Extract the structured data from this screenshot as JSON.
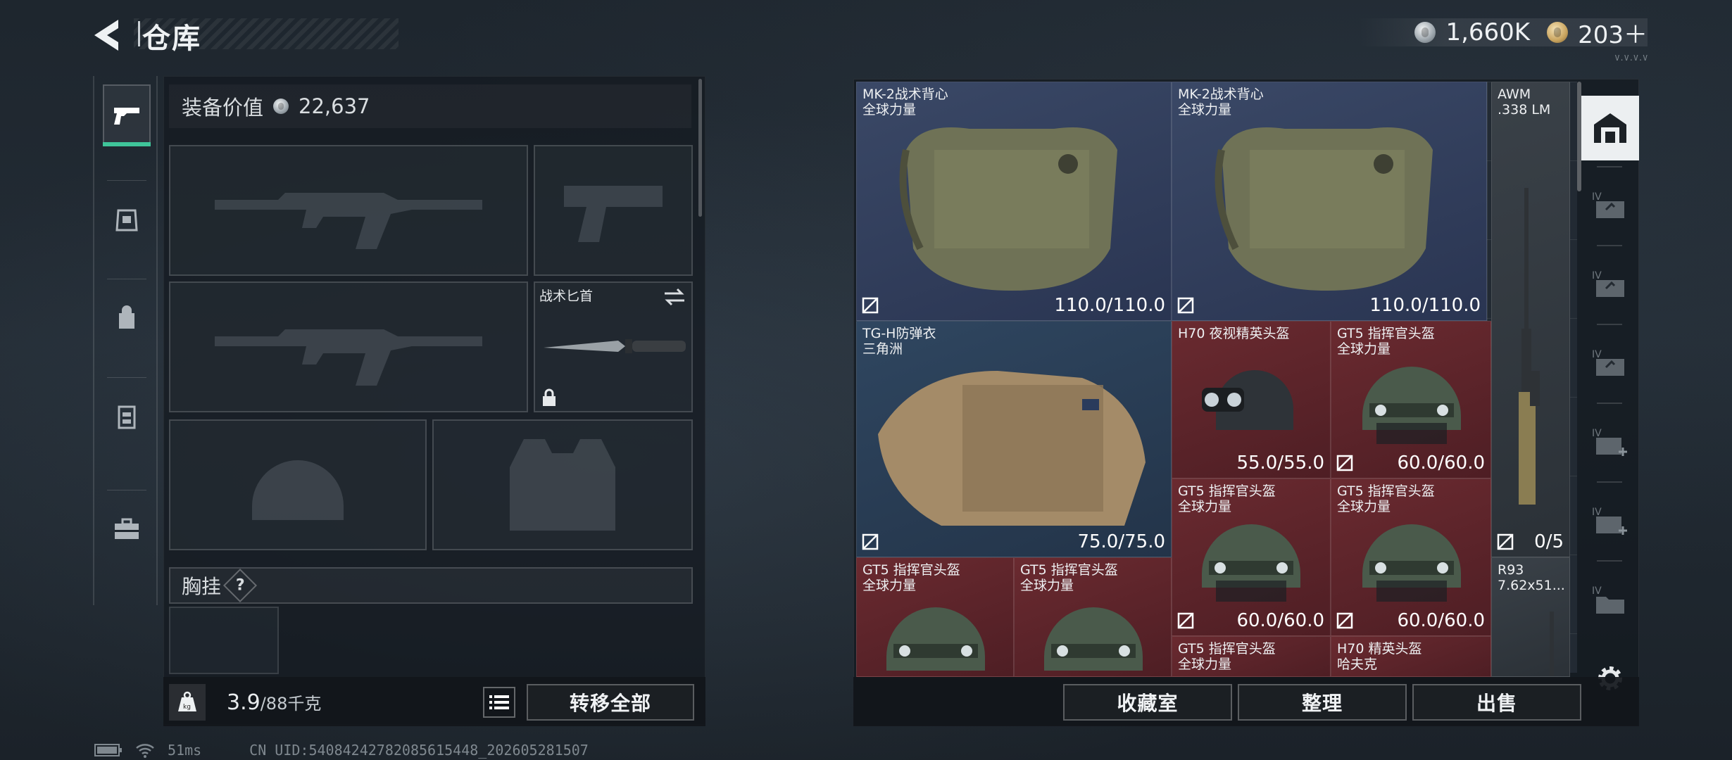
{
  "header": {
    "title": "仓库"
  },
  "currency": {
    "silver": "1,660K",
    "gold": "203＋"
  },
  "version_text": "V.V.V.V",
  "equipment": {
    "value_label": "装备价值",
    "value": "22,637",
    "knife_label": "战术匕首",
    "chest_label": "胸挂",
    "chest_help": "?",
    "weight_value": "3.9",
    "weight_limit": "/88千克",
    "weight_icon_text": "kg",
    "transfer_all": "转移全部"
  },
  "storage": {
    "items": [
      {
        "name": "MK-2战术背心\n全球力量",
        "durability": "110.0/110.0",
        "rarity": "blue"
      },
      {
        "name": "MK-2战术背心\n全球力量",
        "durability": "110.0/110.0",
        "rarity": "blue"
      },
      {
        "name": "AWM\n.338 LM",
        "durability": "0/5",
        "rarity": "grey"
      },
      {
        "name": "TG-H防弹衣\n三角洲",
        "durability": "75.0/75.0",
        "rarity": "blue2"
      },
      {
        "name": "H70 夜视精英头盔",
        "durability": "55.0/55.0",
        "rarity": "red"
      },
      {
        "name": "GT5 指挥官头盔\n全球力量",
        "durability": "60.0/60.0",
        "rarity": "red"
      },
      {
        "name": "GT5 指挥官头盔\n全球力量",
        "durability": "60.0/60.0",
        "rarity": "red"
      },
      {
        "name": "GT5 指挥官头盔\n全球力量",
        "durability": "60.0/60.0",
        "rarity": "red"
      },
      {
        "name": "GT5 指挥官头盔\n全球力量",
        "durability": "",
        "rarity": "red"
      },
      {
        "name": "GT5 指挥官头盔\n全球力量",
        "durability": "",
        "rarity": "red"
      },
      {
        "name": "R93\n7.62x51...",
        "durability": "",
        "rarity": "grey"
      },
      {
        "name": "GT5 指挥官头盔\n全球力量",
        "durability": "",
        "rarity": "red"
      },
      {
        "name": "H70 精英头盔\n哈夫克",
        "durability": "",
        "rarity": "red"
      }
    ],
    "buttons": {
      "vault": "收藏室",
      "sort": "整理",
      "sell": "出售"
    }
  },
  "status_bar": {
    "ping": "51ms",
    "uid": "CN UID:540842427820856154​48_202605281507"
  },
  "colors": {
    "accent": "#3fc59a",
    "rarity_red": "#6a2a30",
    "rarity_blue": "#3a4866"
  }
}
